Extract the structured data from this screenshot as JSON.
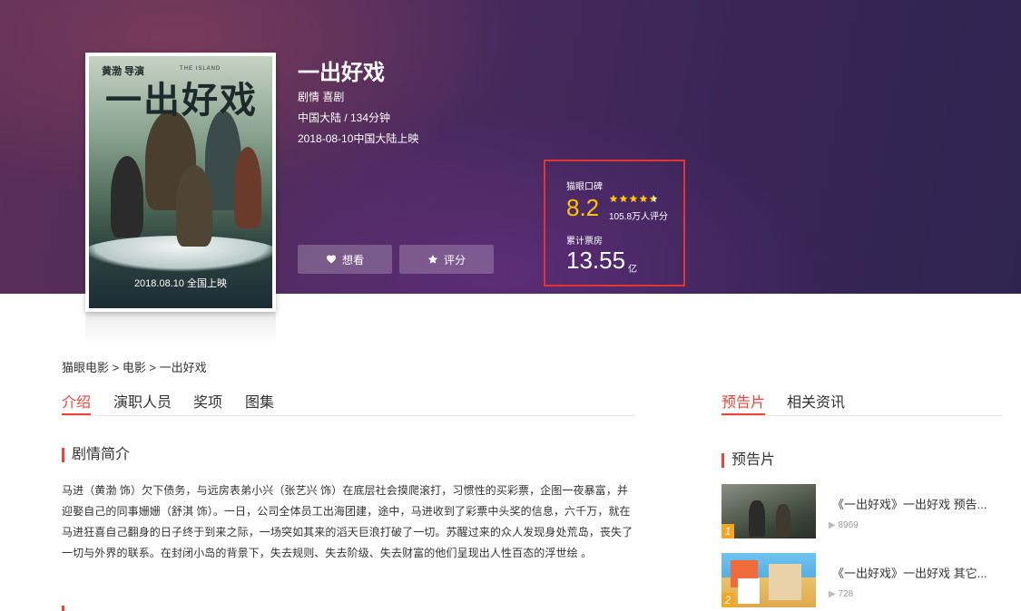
{
  "movie": {
    "title": "一出好戏",
    "genres": "剧情 喜剧",
    "region_duration": "中国大陆 / 134分钟",
    "release": "2018-08-10中国大陆上映"
  },
  "poster": {
    "title_text": "一出好戏",
    "director_text": "黄渤 导演",
    "subtitle_text": "THE ISLAND",
    "date_text": "2018.08.10 全国上映"
  },
  "actions": {
    "want_label": "想看",
    "rate_label": "评分"
  },
  "rating": {
    "label": "猫眼口碑",
    "score": "8.2",
    "stars_filled": 4.5,
    "count": "105.8万人评分",
    "box_label": "累计票房",
    "box_value": "13.55",
    "box_unit": "亿"
  },
  "breadcrumb": "猫眼电影 > 电影 > 一出好戏",
  "tabs": [
    "介绍",
    "演职人员",
    "奖项",
    "图集"
  ],
  "right_tabs": [
    "预告片",
    "相关资讯"
  ],
  "synopsis": {
    "heading": "剧情简介",
    "text": "马进（黄渤 饰）欠下债务，与远房表弟小兴（张艺兴 饰）在底层社会摸爬滚打，习惯性的买彩票，企图一夜暴富，并迎娶自己的同事姗姗（舒淇 饰）。一日，公司全体员工出海团建，途中，马进收到了彩票中头奖的信息，六千万，就在马进狂喜自己翻身的日子终于到来之际，一场突如其来的滔天巨浪打破了一切。苏醒过来的众人发现身处荒岛，丧失了一切与外界的联系。在封闭小岛的背景下，失去规则、失去阶级、失去财富的他们呈现出人性百态的浮世绘 。"
  },
  "trailers": {
    "heading": "预告片",
    "items": [
      {
        "rank": "1",
        "title": "《一出好戏》一出好戏 预告...",
        "plays": "8969"
      },
      {
        "rank": "2",
        "title": "《一出好戏》一出好戏 其它...",
        "plays": "728"
      }
    ]
  },
  "colors": {
    "accent": "#ef4238",
    "score": "#ffc600",
    "highlight_box": "#e4352b"
  }
}
